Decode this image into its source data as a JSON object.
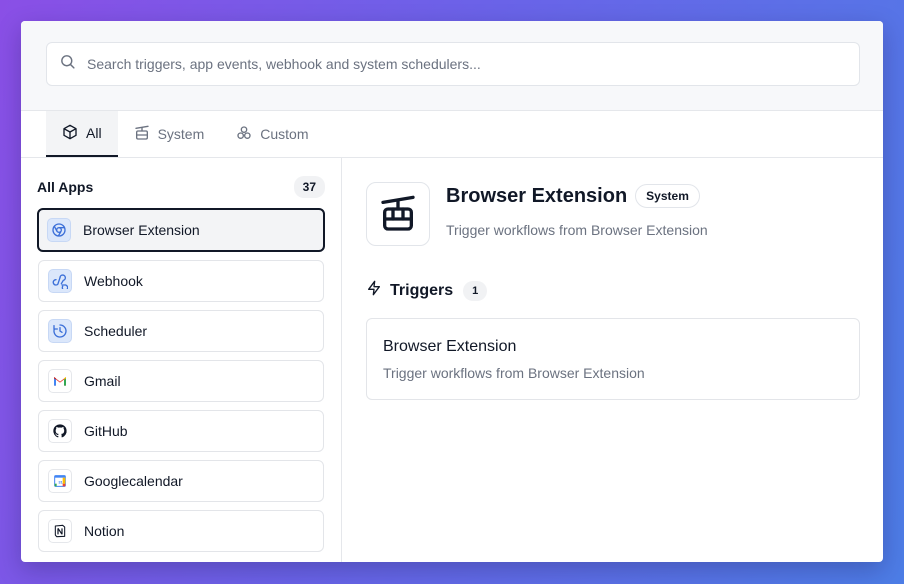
{
  "search": {
    "placeholder": "Search triggers, app events, webhook and system schedulers..."
  },
  "tabs": [
    {
      "label": "All",
      "icon": "box-icon",
      "active": true
    },
    {
      "label": "System",
      "icon": "cable-car-icon",
      "active": false
    },
    {
      "label": "Custom",
      "icon": "components-icon",
      "active": false
    }
  ],
  "sidebar": {
    "title": "All Apps",
    "count": "37",
    "items": [
      {
        "label": "Browser Extension",
        "icon": "chrome-icon",
        "selected": true
      },
      {
        "label": "Webhook",
        "icon": "webhook-icon"
      },
      {
        "label": "Scheduler",
        "icon": "clock-icon"
      },
      {
        "label": "Gmail",
        "icon": "gmail-icon"
      },
      {
        "label": "GitHub",
        "icon": "github-icon"
      },
      {
        "label": "Googlecalendar",
        "icon": "google-calendar-icon"
      },
      {
        "label": "Notion",
        "icon": "notion-icon"
      }
    ]
  },
  "detail": {
    "title": "Browser Extension",
    "badge": "System",
    "description": "Trigger workflows from Browser Extension",
    "triggers_label": "Triggers",
    "triggers_count": "1",
    "triggers": [
      {
        "name": "Browser Extension",
        "description": "Trigger workflows from Browser Extension"
      }
    ]
  },
  "colors": {
    "accent": "#111827",
    "muted": "#6b7280",
    "border": "#e3e5e9",
    "icon_blue_bg": "#dbe7fb"
  }
}
